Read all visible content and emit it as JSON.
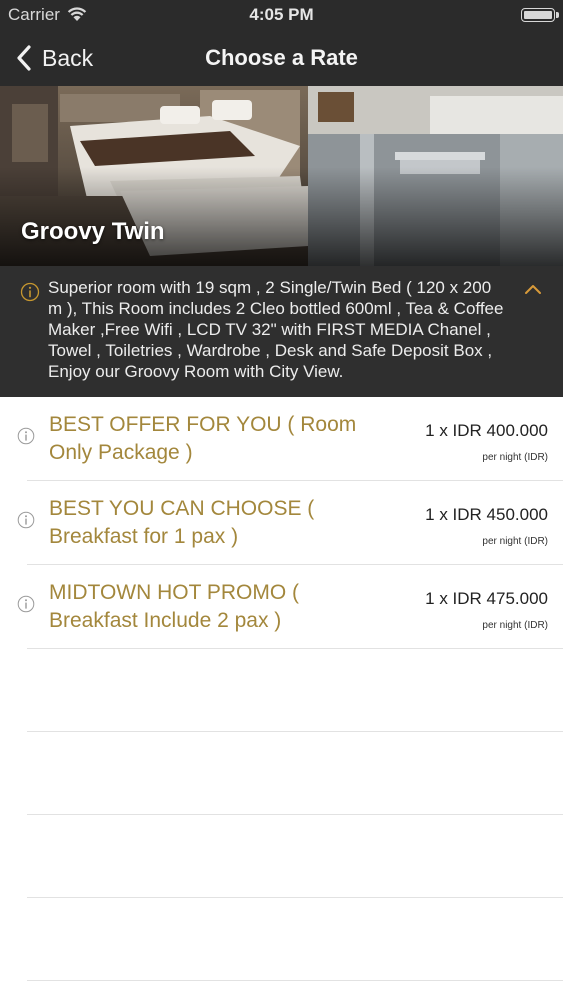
{
  "status_bar": {
    "carrier": "Carrier",
    "time": "4:05 PM"
  },
  "nav": {
    "back_label": "Back",
    "title": "Choose a Rate"
  },
  "room": {
    "name": "Groovy Twin",
    "description": "Superior room with 19 sqm , 2 Single/Twin Bed ( 120 x 200 m ), This Room includes 2 Cleo bottled 600ml , Tea & Coffee Maker ,Free Wifi , LCD TV 32\" with FIRST MEDIA Chanel , Towel , Toiletries , Wardrobe , Desk and Safe Deposit Box , Enjoy our Groovy Room with City View."
  },
  "rates": [
    {
      "title": "BEST OFFER FOR YOU ( Room Only Package )",
      "price": "1 x IDR 400.000",
      "unit": "per night (IDR)"
    },
    {
      "title": "BEST YOU CAN CHOOSE ( Breakfast for 1 pax )",
      "price": "1 x IDR 450.000",
      "unit": "per night (IDR)"
    },
    {
      "title": "MIDTOWN HOT PROMO ( Breakfast Include 2 pax )",
      "price": "1 x IDR 475.000",
      "unit": "per night (IDR)"
    }
  ],
  "colors": {
    "accent": "#a3873c",
    "chevron": "#d89a3a",
    "bar": "#2b2b2b"
  }
}
